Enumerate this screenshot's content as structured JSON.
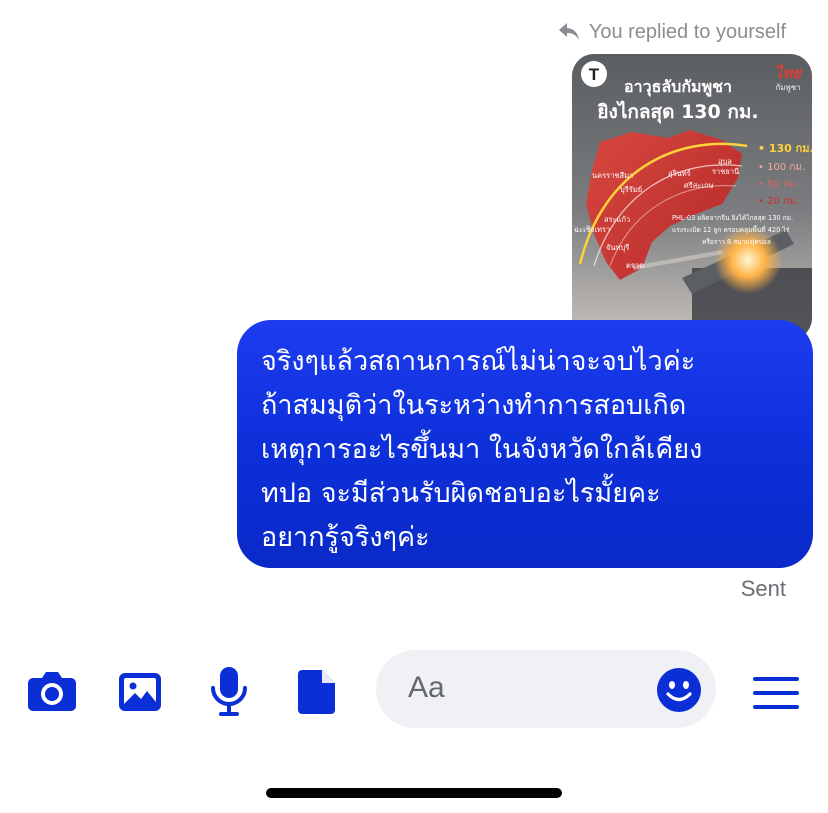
{
  "conversation": {
    "reply_note": "You replied to yourself",
    "replied_media": {
      "logo_letter": "T",
      "headline_line1": "อาวุธลับกัมพูชา",
      "headline_line2": "ยิงไกลสุด 130 กม.",
      "brand_line1": "ไทย",
      "brand_line2": "กัมพูชา",
      "legend": [
        "• 130 กม.",
        "• 100 กม.",
        "• 50 กม.",
        "• 20 กม."
      ],
      "map_labels": [
        "นครราชสีมา",
        "สุรินทร์",
        "อุบล",
        "ราชธานี",
        "บุรีรัมย์",
        "ศรีสะเกษ",
        "สระแก้ว",
        "ฉะเชิงเทรา",
        "จันทบุรี",
        "ตราด"
      ],
      "info_line1": "PHL-03 ผลิตจากจีน ยิงได้ไกลสุด 130 กม.",
      "info_line2": "แรงระเบิด 12 ลูก ครอบคลุมพื้นที่ 420 ไร่",
      "info_line3": "หรือราว 8 สนามฟุตบอล"
    },
    "message": {
      "lines": [
        "จริงๆแล้วสถานการณ์ไม่น่าจะจบไวค่ะ",
        "ถ้าสมมุติว่าในระหว่างทำการสอบเกิด",
        "เหตุการอะไรขึ้นมา ในจังหวัดใกล้เคียง",
        "ทปอ จะมีส่วนรับผิดชอบอะไรมั้ยคะ",
        "อยากรู้จริงๆค่ะ"
      ],
      "status": "Sent"
    }
  },
  "composer": {
    "placeholder": "Aa",
    "tools": [
      "camera-icon",
      "gallery-icon",
      "microphone-icon",
      "file-icon",
      "emoji-icon",
      "menu-icon"
    ],
    "accent_color": "#0a2fd6"
  }
}
